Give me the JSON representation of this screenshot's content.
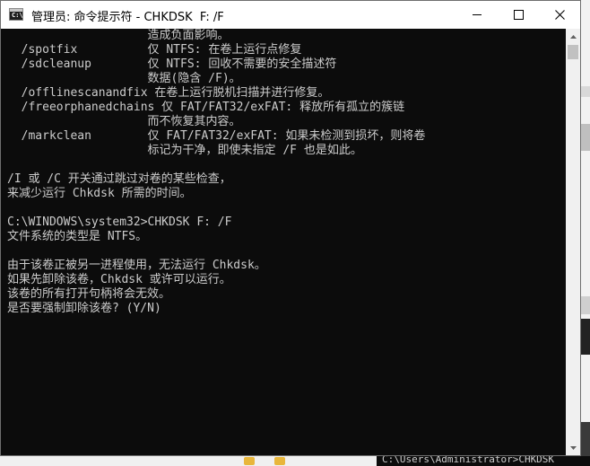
{
  "window": {
    "title": "管理员: 命令提示符 - CHKDSK  F: /F",
    "icon_text": "C:\\"
  },
  "console_lines": [
    "                    造成负面影响。",
    "  /spotfix          仅 NTFS: 在卷上运行点修复",
    "  /sdcleanup        仅 NTFS: 回收不需要的安全描述符",
    "                    数据(隐含 /F)。",
    "  /offlinescanandfix 在卷上运行脱机扫描并进行修复。",
    "  /freeorphanedchains 仅 FAT/FAT32/exFAT: 释放所有孤立的簇链",
    "                    而不恢复其内容。",
    "  /markclean        仅 FAT/FAT32/exFAT: 如果未检测到损坏，则将卷",
    "                    标记为干净，即使未指定 /F 也是如此。",
    "",
    "/I 或 /C 开关通过跳过对卷的某些检查，",
    "来减少运行 Chkdsk 所需的时间。",
    "",
    "C:\\WINDOWS\\system32>CHKDSK F: /F",
    "文件系统的类型是 NTFS。",
    "",
    "由于该卷正被另一进程使用，无法运行 Chkdsk。",
    "如果先卸除该卷，Chkdsk 或许可以运行。",
    "该卷的所有打开句柄将会无效。",
    "是否要强制卸除该卷? (Y/N)"
  ],
  "background": {
    "terminal_snippet": "C:\\Users\\Administrator>CHKDSK"
  },
  "colors": {
    "console_bg": "#0c0c0c",
    "console_text": "#cccccc",
    "titlebar_bg": "#ffffff"
  }
}
